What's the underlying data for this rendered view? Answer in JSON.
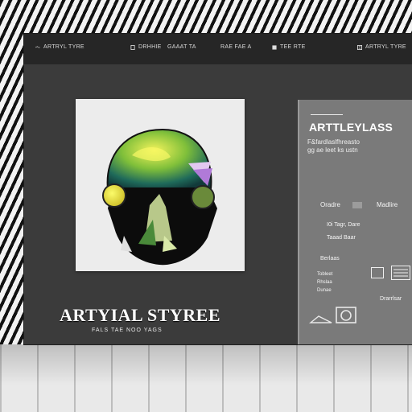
{
  "nav": {
    "items": [
      {
        "label": "ARTRYL TYRE"
      },
      {
        "label": "DRHHIE"
      },
      {
        "label": "GAAAT TA"
      },
      {
        "label": "RAE FAE A"
      },
      {
        "label": "TEE RTE"
      }
    ]
  },
  "panel": {
    "title": "ARTTLEYLASS",
    "sub1": "F&fardlaslfhreasto",
    "sub2": "gg  ae  leet  ks  ustn",
    "sub3": "",
    "option_a": "Oradre",
    "option_b": "Madlire",
    "row1": "I0i  Tagr,  Dare",
    "row2": "Taaad     Baar",
    "section": "Berlaas",
    "list": [
      "Tobleet",
      "Rhslaa",
      "Dunae"
    ],
    "footer": "Drarrlsar"
  },
  "brand": {
    "title": "ARTYIAL STYREE",
    "subtitle": "FALS     TAE    NOO    YAGS"
  },
  "colors": {
    "screen": "#3b3b3b",
    "topbar": "#262626",
    "panel": "#7a7a7a",
    "accent_yellow": "#e9e94a",
    "accent_green": "#3e9e4a"
  },
  "icons": {
    "nav": [
      "logo-icon",
      "file-icon",
      "menu-icon",
      "list-icon",
      "grid-icon"
    ],
    "camera": "camera-icon"
  }
}
